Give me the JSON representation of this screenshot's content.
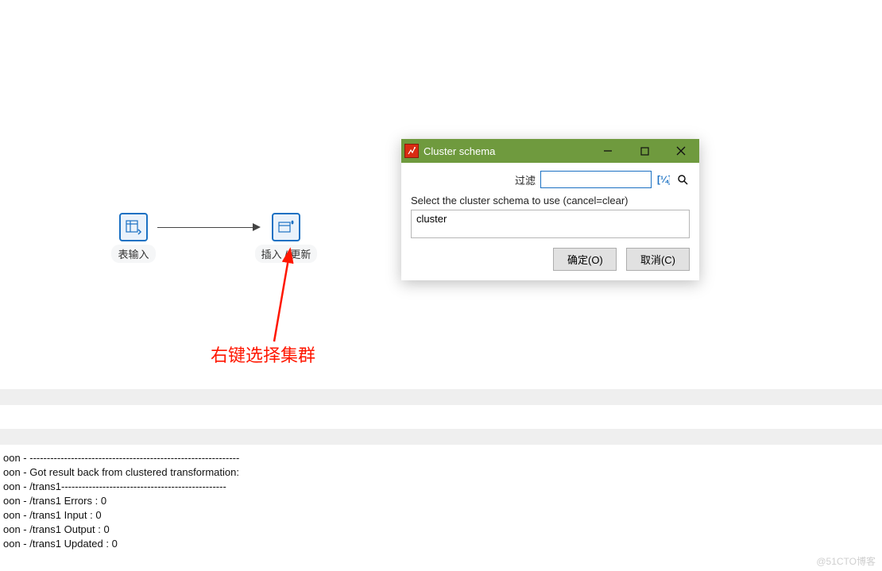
{
  "steps": {
    "tableInput": {
      "label": "表输入"
    },
    "insertUpdate": {
      "label": "插入 / 更新"
    }
  },
  "annotation": {
    "text": "右键选择集群"
  },
  "dialog": {
    "title": "Cluster schema",
    "filter_label": "过滤",
    "filter_value": "",
    "filter_placeholder": "",
    "prompt": "Select the cluster schema to use (cancel=clear)",
    "options": [
      "cluster"
    ],
    "ok_label": "确定(O)",
    "cancel_label": "取消(C)"
  },
  "log": {
    "lines": [
      "oon - -------------------------------------------------------------",
      "oon - Got result back from clustered transformation:",
      "oon - /trans1------------------------------------------------",
      "oon - /trans1 Errors : 0",
      "oon - /trans1 Input : 0",
      "oon - /trans1 Output : 0",
      "oon - /trans1 Updated : 0"
    ]
  },
  "watermark": "@51CTO博客"
}
